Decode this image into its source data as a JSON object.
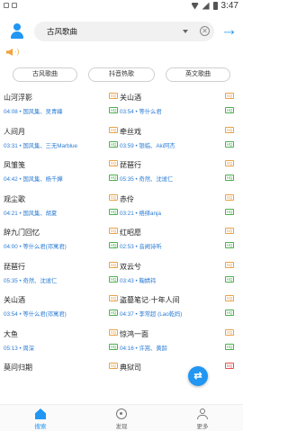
{
  "status_bar": {
    "time": "3:47"
  },
  "search": {
    "query": "古风歌曲",
    "clear_glyph": "✕",
    "go_glyph": "→"
  },
  "speaker": {
    "waves": "·)"
  },
  "tabs": [
    "古风歌曲",
    "抖音热歌",
    "英文歌曲"
  ],
  "badges": {
    "sq": "SQ",
    "hq": "HQ"
  },
  "songs": [
    {
      "title": "山河浮影",
      "meta": "04:08 • 国风集、吴青峰",
      "sq": true,
      "hq": true,
      "sq_red": false
    },
    {
      "title": "关山酒",
      "meta": "03:54 • 等什么君",
      "sq": true,
      "hq": true,
      "sq_red": false
    },
    {
      "title": "人间月",
      "meta": "03:31 • 国风集、三无Marblue",
      "sq": true,
      "hq": true,
      "sq_red": false
    },
    {
      "title": "牵丝戏",
      "meta": "03:59 • 银临、Aki阿杰",
      "sq": true,
      "hq": true,
      "sq_red": false
    },
    {
      "title": "凤雏笺",
      "meta": "04:42 • 国风集、杨千嬅",
      "sq": true,
      "hq": true,
      "sq_red": false
    },
    {
      "title": "琵琶行",
      "meta": "05:35 • 奇然、沈谧仁",
      "sq": true,
      "hq": true,
      "sq_red": false
    },
    {
      "title": "观尘歌",
      "meta": "04:21 • 国风集、胡夏",
      "sq": true,
      "hq": true,
      "sq_red": false
    },
    {
      "title": "赤伶",
      "meta": "03:21 • 络绎anja",
      "sq": true,
      "hq": true,
      "sq_red": false
    },
    {
      "title": "辞九门回忆",
      "meta": "04:00 • 等什么君(邓寓君)",
      "sq": true,
      "hq": true,
      "sq_red": false
    },
    {
      "title": "红昭愿",
      "meta": "02:53 • 音阙诗听",
      "sq": true,
      "hq": true,
      "sq_red": false
    },
    {
      "title": "琵琶行",
      "meta": "05:35 • 奇然、沈谧仁",
      "sq": true,
      "hq": true,
      "sq_red": false
    },
    {
      "title": "双云兮",
      "meta": "03:43 • 鞠婧祎",
      "sq": true,
      "hq": true,
      "sq_red": false
    },
    {
      "title": "关山酒",
      "meta": "03:54 • 等什么君(邓寓君)",
      "sq": true,
      "hq": true,
      "sq_red": false
    },
    {
      "title": "盗墓笔记·十年人间",
      "meta": "04:37 • 李常超 (Lao乾妈)",
      "sq": true,
      "hq": true,
      "sq_red": false
    },
    {
      "title": "大鱼",
      "meta": "05:13 • 周深",
      "sq": true,
      "hq": true,
      "sq_red": false
    },
    {
      "title": "惊鸿一面",
      "meta": "04:16 • 许嵩、黄龄",
      "sq": true,
      "hq": true,
      "sq_red": false
    },
    {
      "title": "莫问归期",
      "meta": "",
      "sq": true,
      "hq": false,
      "sq_red": false
    },
    {
      "title": "典狱司",
      "meta": "",
      "sq": true,
      "hq": false,
      "sq_red": true
    }
  ],
  "fab": {
    "glyph": "⇄"
  },
  "bottom_nav": [
    {
      "label": "搜索",
      "active": true
    },
    {
      "label": "发现",
      "active": false
    },
    {
      "label": "更多",
      "active": false
    }
  ]
}
